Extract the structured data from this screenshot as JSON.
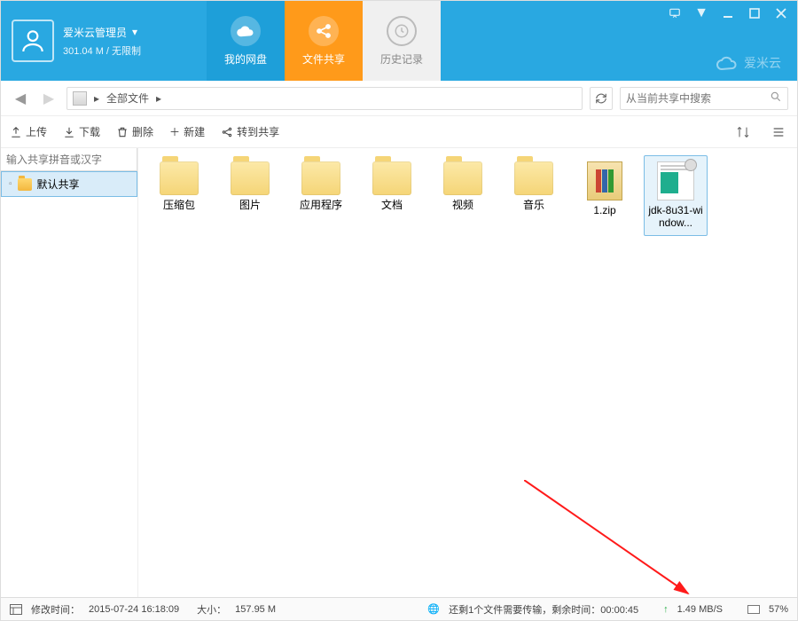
{
  "user": {
    "name": "爱米云管理员",
    "quota": "301.04 M / 无限制"
  },
  "tabs": {
    "disk": "我的网盘",
    "share": "文件共享",
    "history": "历史记录"
  },
  "brand": "爱米云",
  "breadcrumb": {
    "root": "全部文件"
  },
  "search": {
    "placeholder": "从当前共享中搜索"
  },
  "toolbar": {
    "upload": "上传",
    "download": "下载",
    "delete": "删除",
    "new": "新建",
    "share": "转到共享"
  },
  "sidebar": {
    "filter_placeholder": "输入共享拼音或汉字",
    "items": [
      {
        "label": "默认共享"
      }
    ]
  },
  "files": [
    {
      "type": "folder",
      "label": "压缩包"
    },
    {
      "type": "folder",
      "label": "图片"
    },
    {
      "type": "folder",
      "label": "应用程序"
    },
    {
      "type": "folder",
      "label": "文档"
    },
    {
      "type": "folder",
      "label": "视频"
    },
    {
      "type": "folder",
      "label": "音乐"
    },
    {
      "type": "zip",
      "label": "1.zip"
    },
    {
      "type": "file",
      "label": "jdk-8u31-window...",
      "selected": true
    }
  ],
  "status": {
    "modified_label": "修改时间：",
    "modified": "2015-07-24 16:18:09",
    "size_label": "大小：",
    "size": "157.95 M",
    "transfer": "还剩1个文件需要传输，剩余时间：00:00:45",
    "speed": "1.49 MB/S",
    "percent": "57%"
  }
}
